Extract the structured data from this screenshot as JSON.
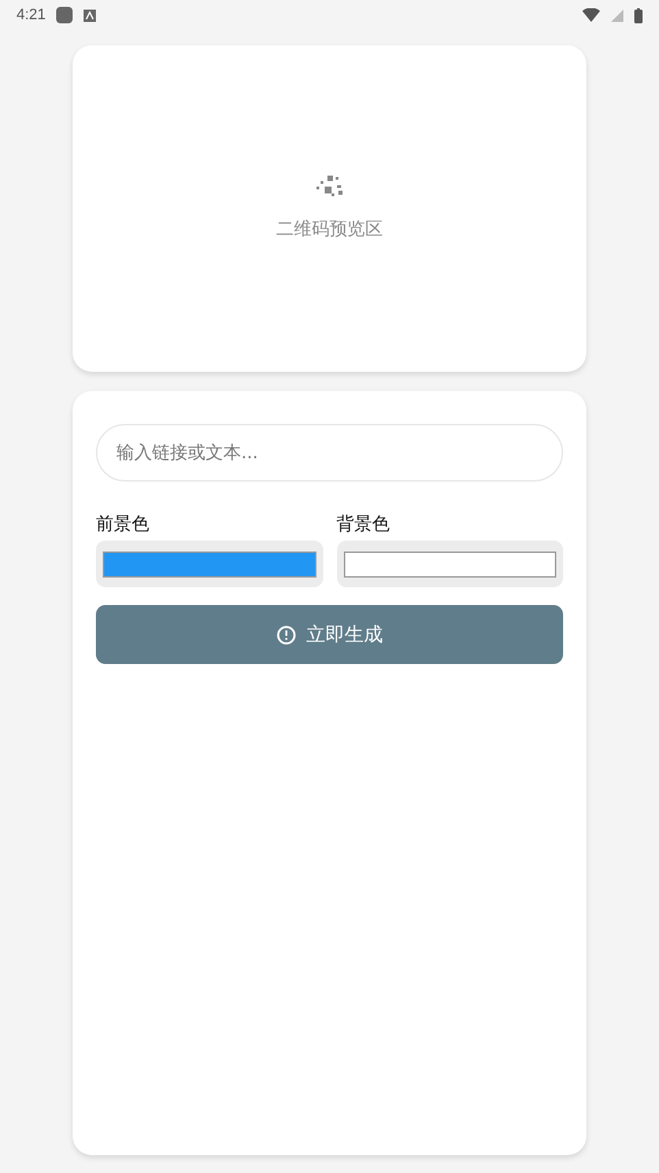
{
  "status_bar": {
    "time": "4:21"
  },
  "preview": {
    "caption": "二维码预览区"
  },
  "form": {
    "input": {
      "placeholder": "输入链接或文本..."
    },
    "colors": [
      {
        "label": "前景色",
        "color": "#2196f3"
      },
      {
        "label": "背景色",
        "color": "#ffffff"
      }
    ],
    "button": {
      "label": "立即生成"
    }
  }
}
